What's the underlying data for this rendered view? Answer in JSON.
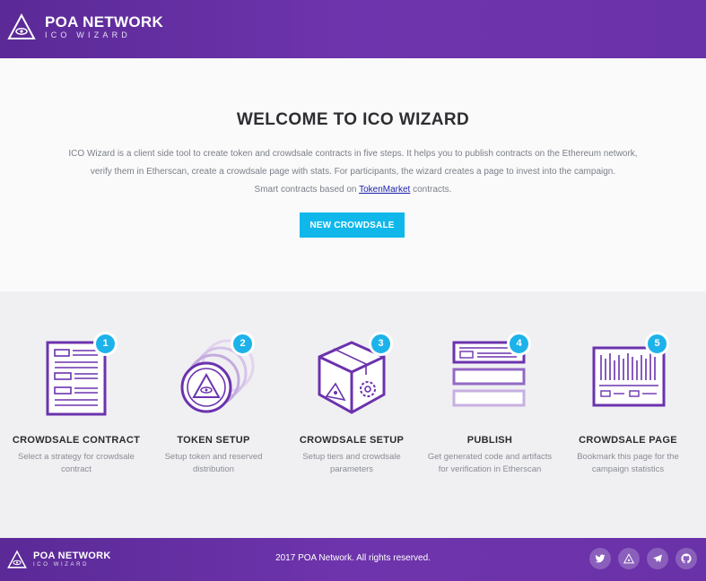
{
  "header": {
    "brand": "POA NETWORK",
    "brand_sub": "ICO WIZARD"
  },
  "hero": {
    "title": "WELCOME TO ICO WIZARD",
    "line1": "ICO Wizard is a client side tool to create token and crowdsale contracts in five steps. It helps you to publish contracts on the Ethereum network,",
    "line2": "verify them in Etherscan, create a crowdsale page with stats. For participants, the wizard creates a page to invest into the campaign.",
    "line3_prefix": "Smart contracts based on ",
    "line3_link": "TokenMarket",
    "line3_suffix": " contracts.",
    "button": "NEW CROWDSALE"
  },
  "steps": [
    {
      "num": "1",
      "title": "CROWDSALE CONTRACT",
      "sub": "Select a strategy for crowdsale contract",
      "icon": "contract-document-icon"
    },
    {
      "num": "2",
      "title": "TOKEN SETUP",
      "sub": "Setup token and reserved distribution",
      "icon": "token-coins-icon"
    },
    {
      "num": "3",
      "title": "CROWDSALE SETUP",
      "sub": "Setup tiers and crowdsale parameters",
      "icon": "crowdsale-box-icon"
    },
    {
      "num": "4",
      "title": "PUBLISH",
      "sub": "Get generated code and artifacts for verification in Etherscan",
      "icon": "publish-forms-icon"
    },
    {
      "num": "5",
      "title": "CROWDSALE PAGE",
      "sub": "Bookmark this page for the campaign statistics",
      "icon": "crowdsale-page-icon"
    }
  ],
  "footer": {
    "brand": "POA NETWORK",
    "brand_sub": "ICO WIZARD",
    "copyright": "2017 POA Network. All rights reserved.",
    "socials": [
      "twitter-icon",
      "poa-icon",
      "telegram-icon",
      "github-icon"
    ]
  },
  "colors": {
    "header_purple": "#6a32a8",
    "accent_blue": "#10b7ea",
    "icon_purple": "#6b33ad"
  }
}
